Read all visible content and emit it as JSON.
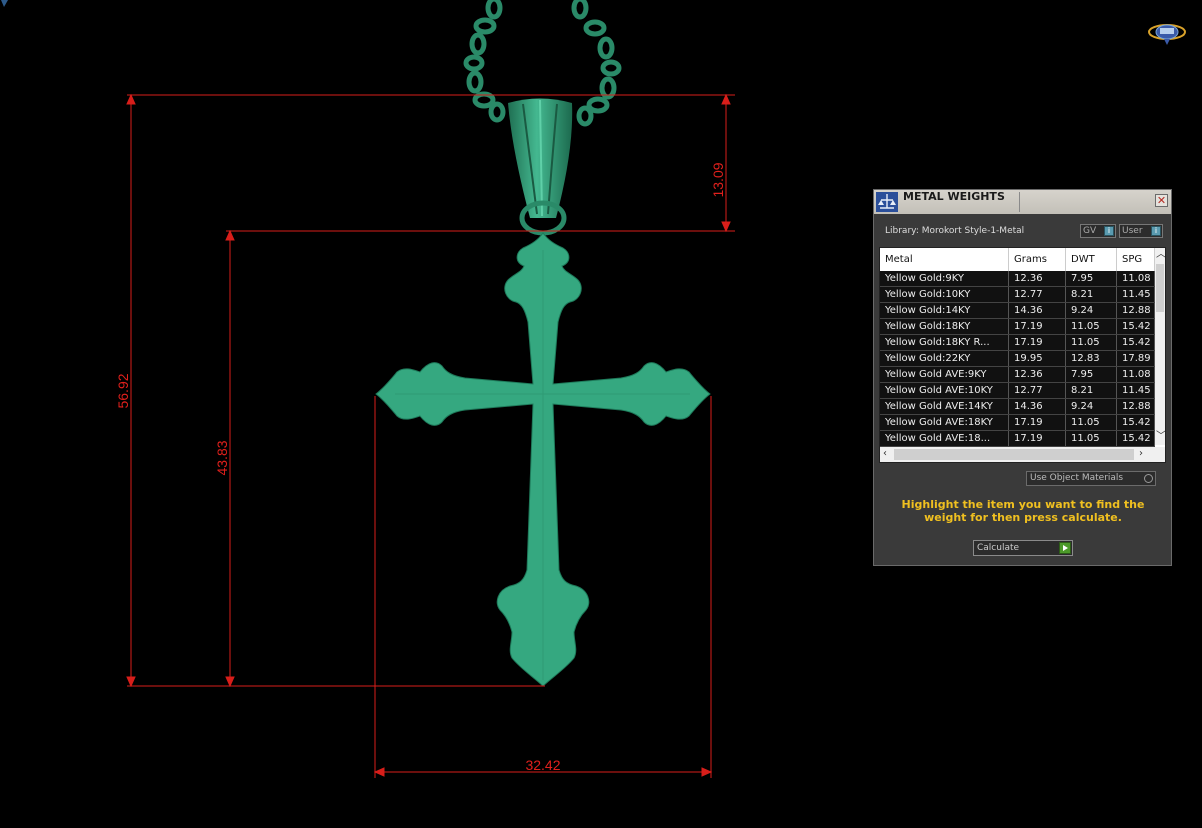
{
  "dimensions": {
    "top_height": "13.09",
    "total_height": "56.92",
    "cross_height": "43.83",
    "cross_width": "32.42"
  },
  "panel": {
    "title": "METAL WEIGHTS",
    "close_glyph": "✕",
    "library_label": "Library: Morokort Style-1-Metal",
    "gv_label": "GV",
    "user_label": "User",
    "columns": [
      "Metal",
      "Grams",
      "DWT",
      "SPG"
    ],
    "rows": [
      [
        "Yellow Gold:9KY",
        "12.36",
        "7.95",
        "11.08"
      ],
      [
        "Yellow Gold:10KY",
        "12.77",
        "8.21",
        "11.45"
      ],
      [
        "Yellow Gold:14KY",
        "14.36",
        "9.24",
        "12.88"
      ],
      [
        "Yellow Gold:18KY",
        "17.19",
        "11.05",
        "15.42"
      ],
      [
        "Yellow Gold:18KY R...",
        "17.19",
        "11.05",
        "15.42"
      ],
      [
        "Yellow Gold:22KY",
        "19.95",
        "12.83",
        "17.89"
      ],
      [
        "Yellow Gold AVE:9KY",
        "12.36",
        "7.95",
        "11.08"
      ],
      [
        "Yellow Gold AVE:10KY",
        "12.77",
        "8.21",
        "11.45"
      ],
      [
        "Yellow Gold AVE:14KY",
        "14.36",
        "9.24",
        "12.88"
      ],
      [
        "Yellow Gold AVE:18KY",
        "17.19",
        "11.05",
        "15.42"
      ],
      [
        "Yellow Gold AVE:18...",
        "17.19",
        "11.05",
        "15.42"
      ]
    ],
    "use_object_materials": "Use Object Materials",
    "instructions": "Highlight the item you want to find the weight for then press calculate.",
    "calculate_label": "Calculate"
  },
  "colors": {
    "model": "#35a880",
    "dimension_lines": "#e0201c",
    "instructions": "#f0c020"
  }
}
